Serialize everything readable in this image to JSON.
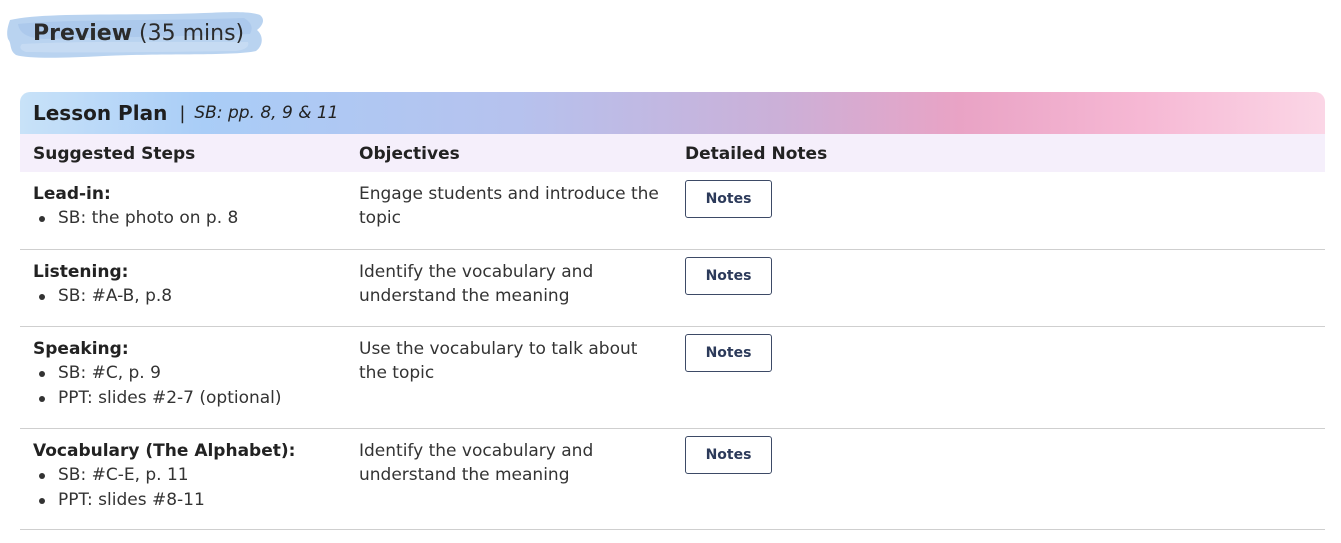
{
  "preview": {
    "title": "Preview",
    "duration": "(35 mins)"
  },
  "lesson_plan": {
    "title": "Lesson Plan",
    "separator": "|",
    "sb_reference": "SB: pp. 8, 9 & 11",
    "columns": {
      "steps": "Suggested Steps",
      "objectives": "Objectives",
      "notes": "Detailed Notes"
    },
    "rows": [
      {
        "step_title": "Lead-in:",
        "items": [
          "SB: the photo on p. 8"
        ],
        "objective": "Engage students and introduce the topic",
        "notes_label": "Notes"
      },
      {
        "step_title": "Listening:",
        "items": [
          "SB: #A-B, p.8"
        ],
        "objective": "Identify the vocabulary and understand the meaning",
        "notes_label": "Notes"
      },
      {
        "step_title": "Speaking:",
        "items": [
          "SB: #C, p. 9",
          "PPT: slides #2-7 (optional)"
        ],
        "objective": "Use the vocabulary to talk about the topic",
        "notes_label": "Notes"
      },
      {
        "step_title": "Vocabulary (The Alphabet):",
        "items": [
          "SB: #C-E, p. 11",
          "PPT: slides #8-11"
        ],
        "objective": "Identify the vocabulary and understand the meaning",
        "notes_label": "Notes"
      }
    ]
  },
  "colors": {
    "badge_blue": "#a9c9ec",
    "header_gradient_start": "#a9cdf7",
    "header_gradient_end": "#fbd6e6",
    "column_header_bg": "#f5effb",
    "button_border": "#3d4a66"
  }
}
